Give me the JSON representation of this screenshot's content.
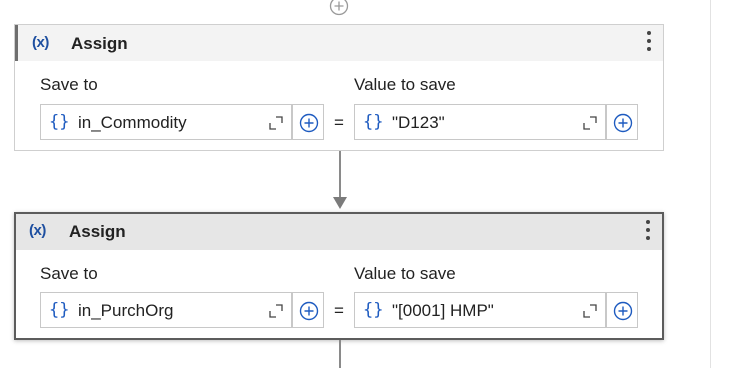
{
  "workflow": {
    "activities": [
      {
        "title": "Assign",
        "icon": "variable-x-icon",
        "selected": false,
        "save_to_label": "Save to",
        "value_label": "Value to save",
        "save_to_value": "in_Commodity",
        "value_to_save": "\"D123\"",
        "equals": "="
      },
      {
        "title": "Assign",
        "icon": "variable-x-icon",
        "selected": true,
        "save_to_label": "Save to",
        "value_label": "Value to save",
        "save_to_value": "in_PurchOrg",
        "value_to_save": "\"[0001] HMP\"",
        "equals": "="
      }
    ],
    "variable_glyph": "(x)",
    "expression_glyph": "{}"
  }
}
